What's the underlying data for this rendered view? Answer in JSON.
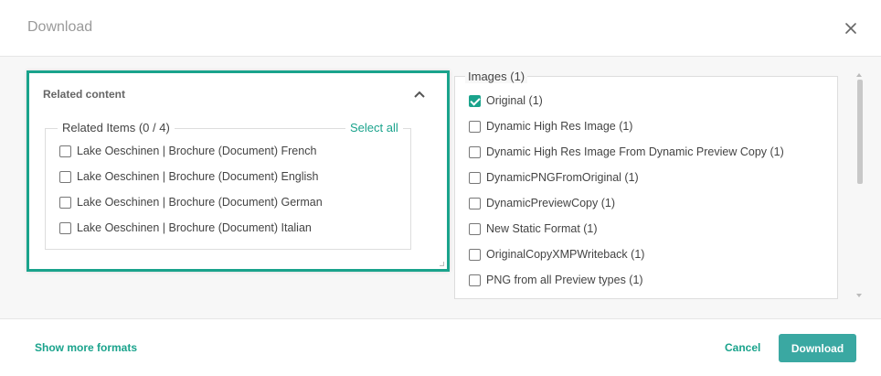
{
  "dialog": {
    "title": "Download"
  },
  "related_content": {
    "title": "Related content",
    "legend": "Related Items (0 / 4)",
    "select_all": "Select all",
    "items": [
      {
        "label": "Lake Oeschinen | Brochure (Document) French",
        "checked": false
      },
      {
        "label": "Lake Oeschinen | Brochure (Document) English",
        "checked": false
      },
      {
        "label": "Lake Oeschinen | Brochure (Document) German",
        "checked": false
      },
      {
        "label": "Lake Oeschinen | Brochure (Document) Italian",
        "checked": false
      }
    ]
  },
  "images": {
    "legend": "Images (1)",
    "items": [
      {
        "label": "Original (1)",
        "checked": true
      },
      {
        "label": "Dynamic High Res Image (1)",
        "checked": false
      },
      {
        "label": "Dynamic High Res Image From Dynamic Preview Copy (1)",
        "checked": false
      },
      {
        "label": "DynamicPNGFromOriginal (1)",
        "checked": false
      },
      {
        "label": "DynamicPreviewCopy (1)",
        "checked": false
      },
      {
        "label": "New Static Format (1)",
        "checked": false
      },
      {
        "label": "OriginalCopyXMPWriteback (1)",
        "checked": false
      },
      {
        "label": "PNG from all Preview types (1)",
        "checked": false
      }
    ]
  },
  "footer": {
    "show_more": "Show more formats",
    "cancel": "Cancel",
    "download": "Download"
  },
  "colors": {
    "accent": "#1aa38c",
    "button": "#3aa8a2"
  }
}
